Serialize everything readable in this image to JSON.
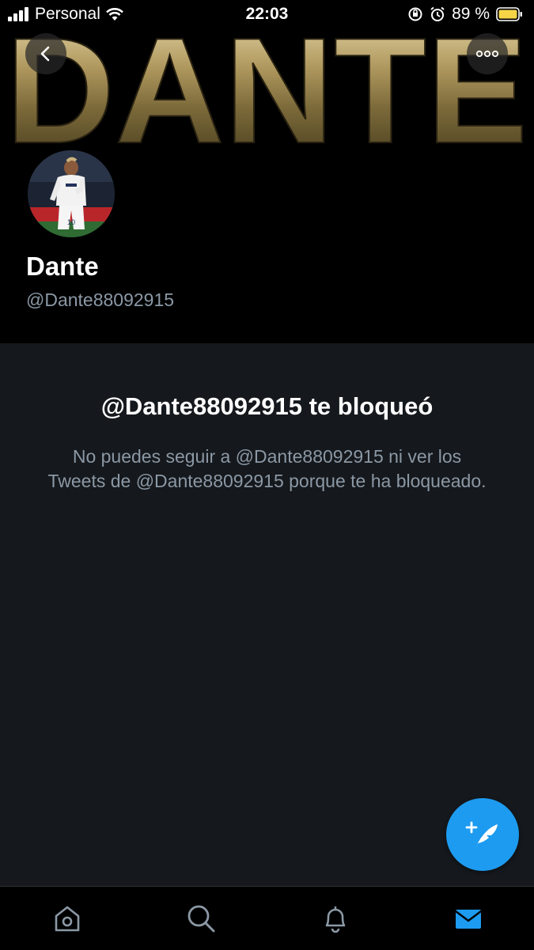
{
  "status_bar": {
    "carrier": "Personal",
    "time": "22:03",
    "battery_percent": "89 %"
  },
  "banner": {
    "text": "DANTE"
  },
  "profile": {
    "display_name": "Dante",
    "handle": "@Dante88092915"
  },
  "blocked": {
    "title": "@Dante88092915 te bloqueó",
    "description": "No puedes seguir a @Dante88092915 ni ver los Tweets de @Dante88092915 porque te ha bloqueado."
  },
  "icons": {
    "back": "chevron-left-icon",
    "more": "more-horizontal-icon",
    "compose": "compose-tweet-icon",
    "home": "home-icon",
    "search": "search-icon",
    "notifications": "bell-icon",
    "messages": "mail-icon"
  },
  "colors": {
    "accent": "#1d9bf0",
    "background": "#15181c",
    "header_background": "#000000",
    "secondary_text": "#8b98a5",
    "banner_gold": "#b8a470",
    "battery": "#f5d547"
  }
}
